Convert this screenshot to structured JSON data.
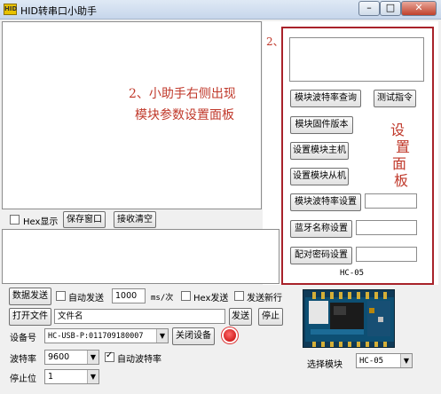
{
  "window": {
    "title": "HID转串口小助手",
    "app_icon_text": "HID",
    "controls": {
      "minimize": "–",
      "maximize": "□",
      "close": "✕"
    }
  },
  "annotation": {
    "step_marker": "2、",
    "line1": "2、小助手右侧出现",
    "line2": "模块参数设置面板",
    "panel_label": [
      "设",
      "置",
      "面",
      "板"
    ]
  },
  "settings_panel": {
    "btn_query_baud": "模块波特率查询",
    "btn_test_cmd": "测试指令",
    "btn_firmware": "模块固件版本",
    "btn_set_master": "设置模块主机",
    "btn_set_slave": "设置模块从机",
    "btn_set_baud": "模块波特率设置",
    "btn_bt_name": "蓝牙名称设置",
    "btn_pair_pwd": "配对密码设置",
    "module_name": "HC-05"
  },
  "receive_bar": {
    "hex_display": "Hex显示",
    "save_window": "保存窗口",
    "clear_receive": "接收清空"
  },
  "bottom": {
    "data_send": "数据发送",
    "auto_send": "自动发送",
    "interval_value": "1000",
    "interval_unit": "ms/次",
    "hex_send": "Hex发送",
    "send_newline": "发送新行",
    "open_file": "打开文件",
    "filename_placeholder": "文件名",
    "send": "发送",
    "stop": "停止",
    "device_label": "设备号",
    "device_value": "HC-USB-P:011709180007",
    "close_device": "关闭设备",
    "baud_label": "波特率",
    "baud_value": "9600",
    "auto_baud": "自动波特率",
    "stopbit_label": "停止位",
    "stopbit_value": "1",
    "select_module_label": "选择模块",
    "select_module_value": "HC-05"
  },
  "colors": {
    "annotation_red": "#c0392b",
    "frame_red": "#a8222a",
    "pcb_blue": "#0f3a57"
  }
}
